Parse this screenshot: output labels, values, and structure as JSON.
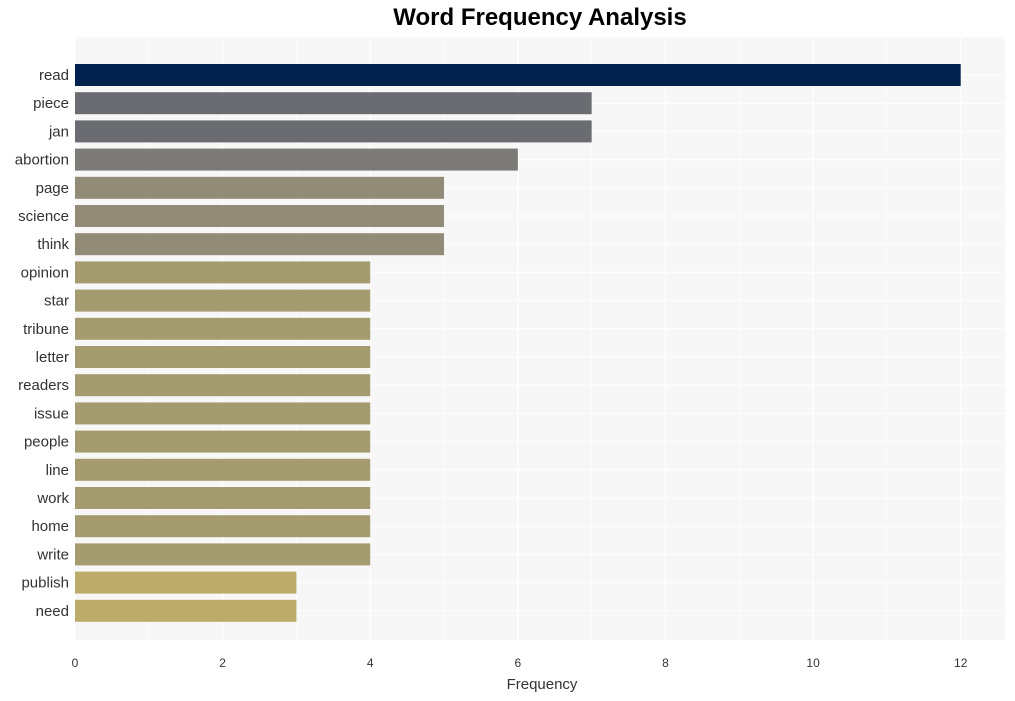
{
  "chart_data": {
    "type": "bar",
    "orientation": "horizontal",
    "title": "Word Frequency Analysis",
    "xlabel": "Frequency",
    "ylabel": "",
    "xlim": [
      0,
      12.6
    ],
    "xticks": [
      0,
      2,
      4,
      6,
      8,
      10,
      12
    ],
    "grid": true,
    "legend": "none",
    "categories": [
      "read",
      "piece",
      "jan",
      "abortion",
      "page",
      "science",
      "think",
      "opinion",
      "star",
      "tribune",
      "letter",
      "readers",
      "issue",
      "people",
      "line",
      "work",
      "home",
      "write",
      "publish",
      "need"
    ],
    "values": [
      12,
      7,
      7,
      6,
      5,
      5,
      5,
      4,
      4,
      4,
      4,
      4,
      4,
      4,
      4,
      4,
      4,
      4,
      3,
      3
    ],
    "colors": [
      "#00204e",
      "#6b6c72",
      "#6b6c72",
      "#7c7b78",
      "#928b77",
      "#928b77",
      "#928b77",
      "#a59b71",
      "#a59b71",
      "#a59b71",
      "#a59b71",
      "#a59b71",
      "#a59b71",
      "#a59b71",
      "#a59b71",
      "#a59b71",
      "#a59b71",
      "#a59b71",
      "#bcac6c",
      "#bcac6c"
    ]
  },
  "style": {
    "plot_background": "#f7f7f7",
    "grid_color": "#ffffff"
  }
}
